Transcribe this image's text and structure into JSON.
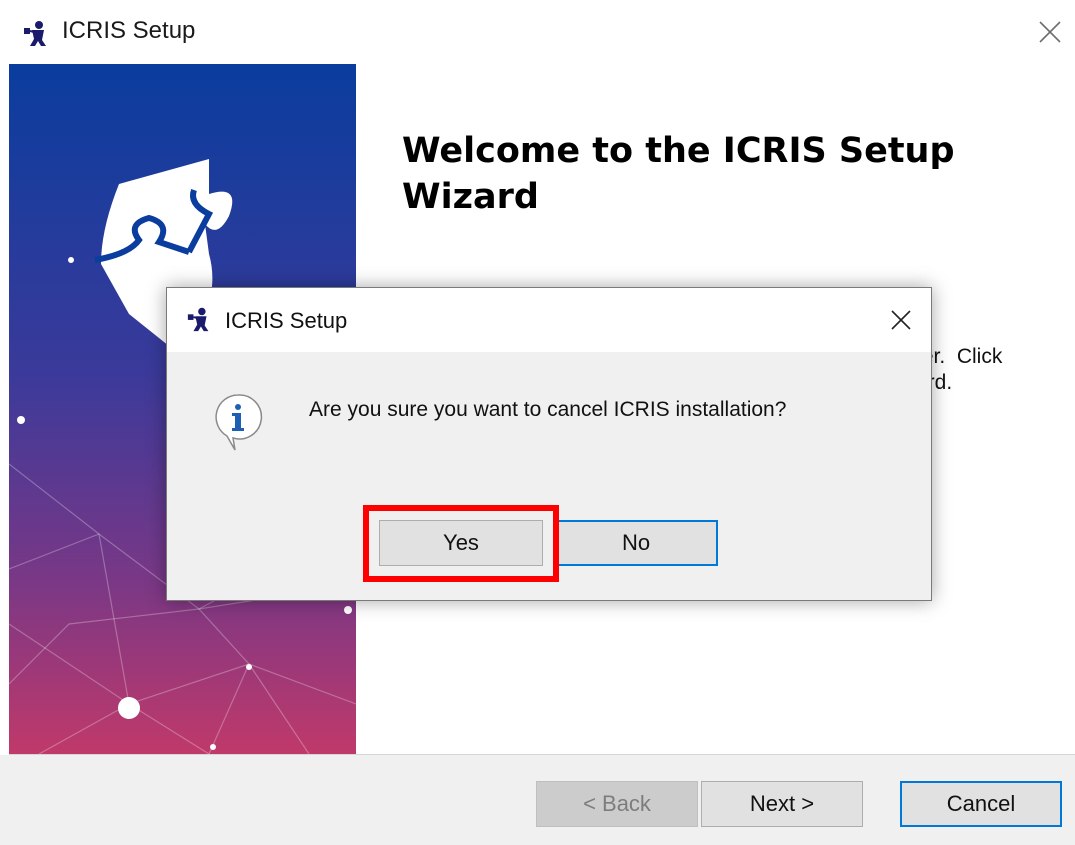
{
  "window": {
    "title": "ICRIS Setup",
    "icon": "icris-app-icon",
    "close_icon": "close-icon"
  },
  "wizard": {
    "welcome_heading": "Welcome to the ICRIS Setup Wizard",
    "partial_text_line1": "ter.  Click",
    "partial_text_line2": "ard."
  },
  "footer": {
    "back_label": "< Back",
    "next_label": "Next >",
    "cancel_label": "Cancel"
  },
  "dialog": {
    "title": "ICRIS Setup",
    "message": "Are you sure you want to cancel ICRIS installation?",
    "icon": "info-icon",
    "yes_label": "Yes",
    "no_label": "No"
  },
  "colors": {
    "banner_top": "#0a3d9e",
    "banner_bottom": "#c0396a",
    "focus_border": "#0078d7",
    "highlight": "#ff0000"
  }
}
